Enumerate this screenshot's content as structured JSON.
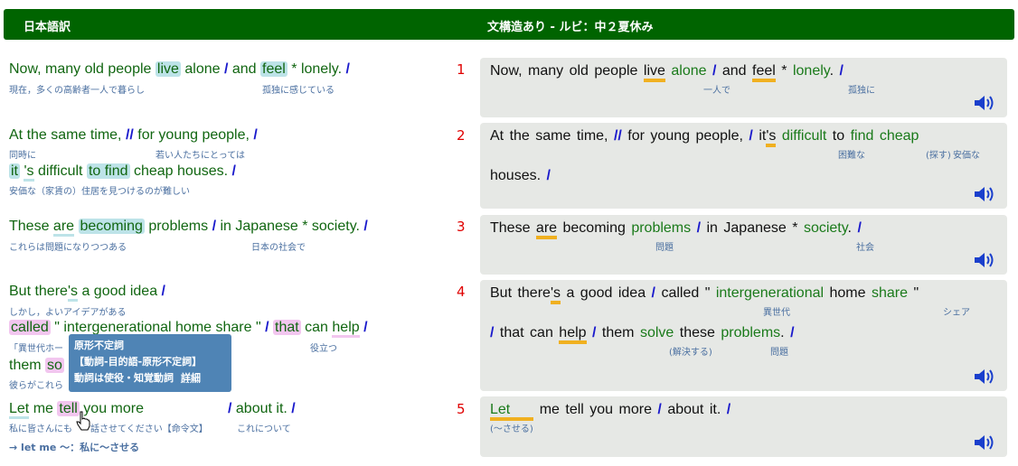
{
  "header": {
    "left_title": "日本語訳",
    "right_title": "文構造あり - ルビ：中２夏休み"
  },
  "left": {
    "s1": {
      "a": "Now, many old people",
      "b": "live",
      "c": "alone",
      "d": "/",
      "e": "and",
      "f": "feel",
      "g": "* lonely.",
      "h": "/",
      "gloss1": "現在，多くの高齢者一人で暮らし",
      "gloss2": "孤独に感じている"
    },
    "s2": {
      "a": "At the same time,",
      "b": "//",
      "c": "for young people,",
      "d": "/",
      "gloss1": "同時に",
      "gloss2": "若い人たちにとっては",
      "e": "it",
      "f": "'s",
      "g": "difficult",
      "h": "to find",
      "i": "cheap houses.",
      "j": "/",
      "gloss3": "安価な（家賃の）住居を見つけるのが難しい"
    },
    "s3": {
      "a": "These",
      "b": "are",
      "c": "becoming",
      "d": "problems",
      "e": "/",
      "f": "in Japanese * society.",
      "g": "/",
      "gloss1": "これらは問題になりつつある",
      "gloss2": "日本の社会で"
    },
    "s4": {
      "a": "But there",
      "b": "'s",
      "c": "a good idea",
      "d": "/",
      "gloss1": "しかし，よいアイデアがある",
      "e": "called",
      "f": "\" intergenerational home share \"",
      "g": "/",
      "h": "that",
      "i": "can",
      "j": "help",
      "k": "/",
      "gloss2": "「異世代ホー",
      "gloss3": "役立つ",
      "l": "them",
      "m": "so",
      "gloss4": "彼らがこれら"
    },
    "s5": {
      "a": "Let",
      "b": "me",
      "c": "tell",
      "d": "you more",
      "e": "/",
      "f": "about it.",
      "g": "/",
      "gloss1": "私に皆さんにも",
      "gloss2": "話させてください【命令文】",
      "gloss3": "これについて"
    },
    "note": "→ let me 〜：私に〜させる"
  },
  "tooltip": {
    "line1": "原形不定詞",
    "line2": "【動詞-目的語-原形不定詞】",
    "line3": "動詞は使役・知覚動詞",
    "link": "詳細"
  },
  "numbers": [
    "1",
    "2",
    "3",
    "4",
    "5"
  ],
  "right": {
    "r1": {
      "a": "Now, many old people",
      "b": "live",
      "c": "alone",
      "d": "/",
      "e": "and",
      "f": "feel",
      "g": "*",
      "h": "lonely",
      "i": ".",
      "j": "/",
      "gl1": "一人で",
      "gl2": "孤独に"
    },
    "r2": {
      "a": "At the same time,",
      "b": "//",
      "c": "for young people,",
      "d": "/",
      "e": "it",
      "f": "'s",
      "g": "difficult",
      "h": "to",
      "i": "find",
      "j": "cheap",
      "k": "houses.",
      "l": "/",
      "gl1": "困難な",
      "gl2": "(探す)",
      "gl3": "安価な"
    },
    "r3": {
      "a": "These",
      "b": "are",
      "c": "becoming",
      "d": "problems",
      "e": "/",
      "f": "in Japanese",
      "g": "*",
      "h": "society",
      "i": ".",
      "j": "/",
      "gl1": "問題",
      "gl2": "社会"
    },
    "r4": {
      "a": "But there",
      "b": "'s",
      "c": "a good idea",
      "d": "/",
      "e": "called \"",
      "f": "intergenerational",
      "g": "home",
      "h": "share",
      "i": "\"",
      "gl1": "異世代",
      "gl2": "シェア",
      "j": "/",
      "k": "that can",
      "l": "help",
      "m": "/",
      "n": "them",
      "o": "solve",
      "p": "these",
      "q": "problems",
      "r": ".",
      "s": "/",
      "gl3": "(解決する)",
      "gl4": "問題"
    },
    "r5": {
      "a": "Let",
      "b": "me tell you more",
      "c": "/",
      "d": "about it.",
      "e": "/",
      "gl1": "(〜させる)"
    }
  },
  "icons": {
    "speaker": "speaker-icon",
    "cursor": "hand-cursor-icon"
  },
  "colors": {
    "header": "#006400",
    "green_text": "#116611",
    "slash": "#1a1acc",
    "number": "#e00000",
    "highlight_blue": "#bde3e8",
    "highlight_pink": "#f2c6ef",
    "underline_yellow": "#f0b020",
    "tooltip": "#4f84b5"
  }
}
